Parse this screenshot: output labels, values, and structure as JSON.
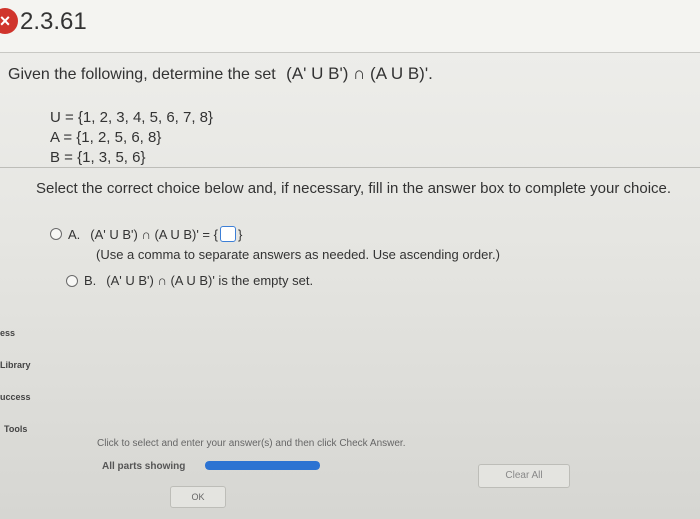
{
  "header": {
    "problem_number": "2.3.61",
    "status_icon": "incorrect-x-icon",
    "status_color": "#d0342c"
  },
  "question": {
    "prompt": "Given the following, determine the set",
    "expression": "(A' U B') ∩ (A U B)'."
  },
  "sets": {
    "U": "U = {1, 2, 3, 4, 5, 6, 7, 8}",
    "A": "A = {1, 2, 5, 6, 8}",
    "B": "B = {1, 3, 5, 6}"
  },
  "instruction": "Select the correct choice below and, if necessary, fill in the answer box to complete your choice.",
  "choices": {
    "a": {
      "letter": "A.",
      "text_before": "(A' U B') ∩ (A U B)' = {",
      "text_after": "}",
      "hint": "(Use a comma to separate answers as needed. Use ascending order.)"
    },
    "b": {
      "letter": "B.",
      "text": "(A' U B') ∩ (A U B)' is the empty set."
    }
  },
  "sidebar": {
    "items": [
      "ess",
      "Library",
      "uccess",
      "Tools"
    ]
  },
  "footer": {
    "note": "Click to select and enter your answer(s) and then click Check Answer.",
    "parts_label": "All parts showing",
    "progress": 1.0,
    "clear_label": "Clear All",
    "ok_label": "OK"
  }
}
